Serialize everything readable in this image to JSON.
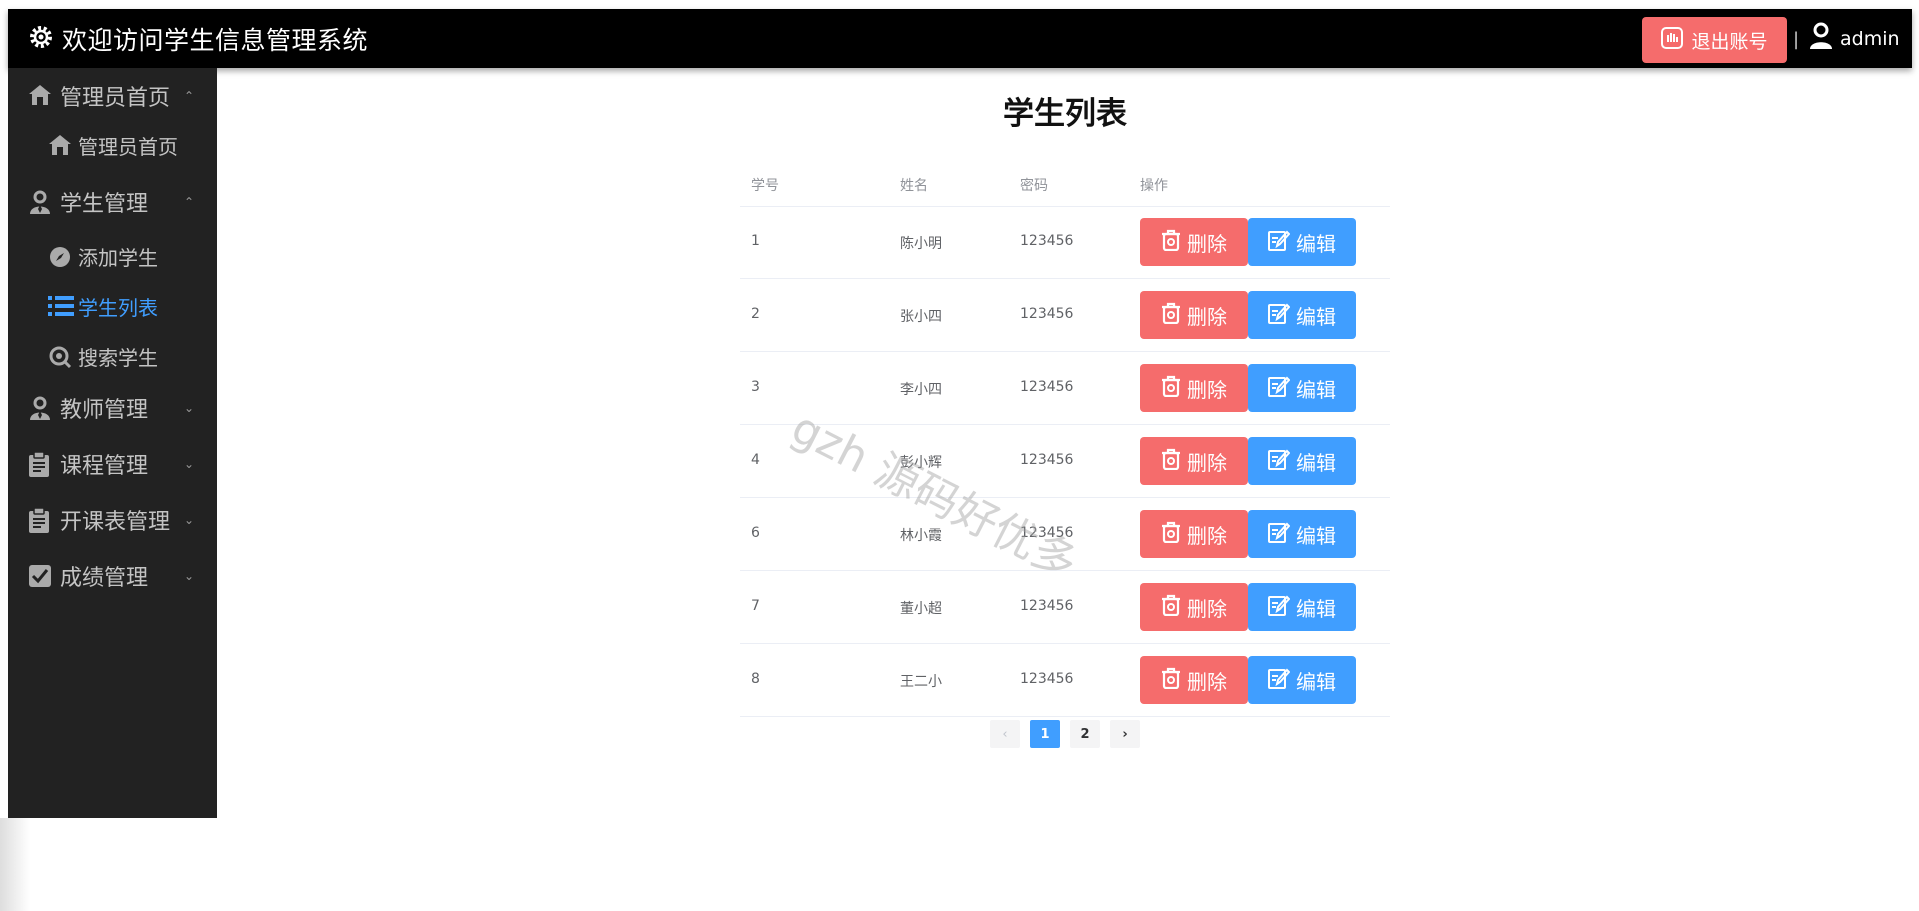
{
  "header": {
    "title": "欢迎访问学生信息管理系统",
    "logout_label": "退出账号",
    "separator": "|",
    "username": "admin",
    "icons": {
      "logo": "gear-icon",
      "logout": "hand-stop-icon",
      "user": "user-icon"
    }
  },
  "sidebar": {
    "groups": [
      {
        "label": "管理员首页",
        "icon": "home-icon",
        "expanded": true,
        "chevron": "⌃"
      },
      {
        "label": "学生管理",
        "icon": "user-tie-icon",
        "expanded": true,
        "chevron": "⌃"
      },
      {
        "label": "教师管理",
        "icon": "user-tie-icon",
        "expanded": false,
        "chevron": "⌄"
      },
      {
        "label": "课程管理",
        "icon": "clipboard-icon",
        "expanded": false,
        "chevron": "⌄"
      },
      {
        "label": "开课表管理",
        "icon": "clipboard-icon",
        "expanded": false,
        "chevron": "⌄"
      },
      {
        "label": "成绩管理",
        "icon": "checkbox-icon",
        "expanded": false,
        "chevron": "⌄"
      }
    ],
    "sub_items": [
      {
        "label": "管理员首页",
        "icon": "home-icon",
        "active": false
      },
      {
        "label": "添加学生",
        "icon": "compass-icon",
        "active": false
      },
      {
        "label": "学生列表",
        "icon": "list-icon",
        "active": true
      },
      {
        "label": "搜索学生",
        "icon": "search-icon",
        "active": false
      }
    ]
  },
  "main": {
    "title": "学生列表",
    "columns": [
      "学号",
      "姓名",
      "密码",
      "操作"
    ],
    "rows": [
      {
        "id": "1",
        "name": "陈小明",
        "password": "123456"
      },
      {
        "id": "2",
        "name": "张小四",
        "password": "123456"
      },
      {
        "id": "3",
        "name": "李小四",
        "password": "123456"
      },
      {
        "id": "4",
        "name": "彭小辉",
        "password": "123456"
      },
      {
        "id": "6",
        "name": "林小霞",
        "password": "123456"
      },
      {
        "id": "7",
        "name": "董小超",
        "password": "123456"
      },
      {
        "id": "8",
        "name": "王二小",
        "password": "123456"
      }
    ],
    "delete_label": "删除",
    "edit_label": "编辑",
    "pagination": {
      "prev": "‹",
      "pages": [
        "1",
        "2"
      ],
      "current": "1",
      "next": "›"
    }
  },
  "watermark": "gzh 源码好优多",
  "colors": {
    "danger": "#f56c6c",
    "primary": "#409eff",
    "sidebar_bg": "#222222",
    "header_bg": "#000000"
  }
}
